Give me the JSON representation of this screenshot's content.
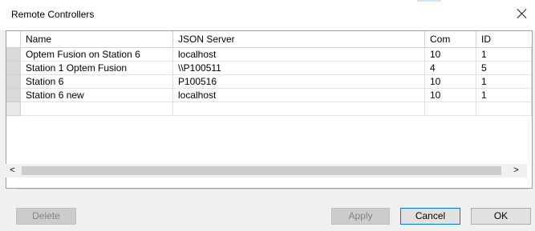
{
  "window": {
    "title": "Remote Controllers"
  },
  "grid": {
    "columns": [
      "Name",
      "JSON Server",
      "Com",
      "ID"
    ],
    "rows": [
      [
        "Optem Fusion on Station 6",
        "localhost",
        "10",
        "1"
      ],
      [
        "Station 1 Optem Fusion",
        "\\\\P100511",
        "4",
        "5"
      ],
      [
        "Station 6",
        "P100516",
        "10",
        "1"
      ],
      [
        "Station 6 new",
        "localhost",
        "10",
        "1"
      ]
    ]
  },
  "scrollbar": {
    "left_arrow": "<",
    "right_arrow": ">"
  },
  "buttons": {
    "delete": "Delete",
    "apply": "Apply",
    "cancel": "Cancel",
    "ok": "OK"
  }
}
